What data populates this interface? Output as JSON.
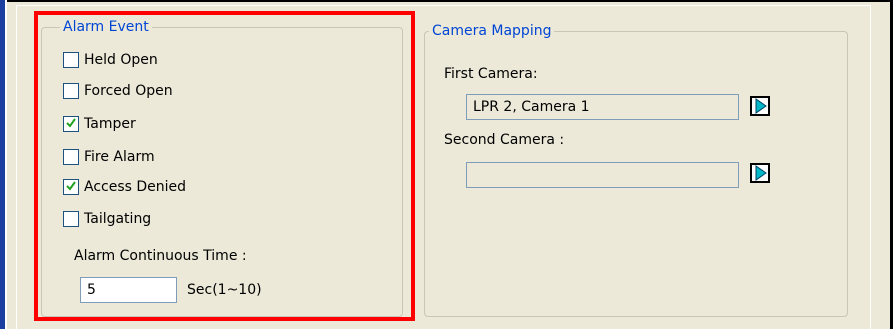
{
  "alarm_event": {
    "legend": "Alarm Event",
    "checkboxes": [
      {
        "label": "Held Open",
        "checked": false
      },
      {
        "label": "Forced Open",
        "checked": false
      },
      {
        "label": "Tamper",
        "checked": true
      },
      {
        "label": "Fire Alarm",
        "checked": false
      },
      {
        "label": "Access Denied",
        "checked": true
      },
      {
        "label": "Tailgating",
        "checked": false
      }
    ],
    "continuous_time_label": "Alarm Continuous Time :",
    "continuous_time_value": "5",
    "continuous_time_unit": "Sec(1~10)"
  },
  "camera_mapping": {
    "legend": "Camera Mapping",
    "first_camera_label": "First Camera:",
    "first_camera_value": "LPR 2, Camera 1",
    "second_camera_label": "Second Camera :",
    "second_camera_value": ""
  },
  "colors": {
    "highlight": "#ff0000",
    "legend_text": "#0046d5",
    "arrow_icon": "#00b8c8"
  },
  "icons": [
    "checkmark-icon",
    "play-arrow-icon"
  ]
}
